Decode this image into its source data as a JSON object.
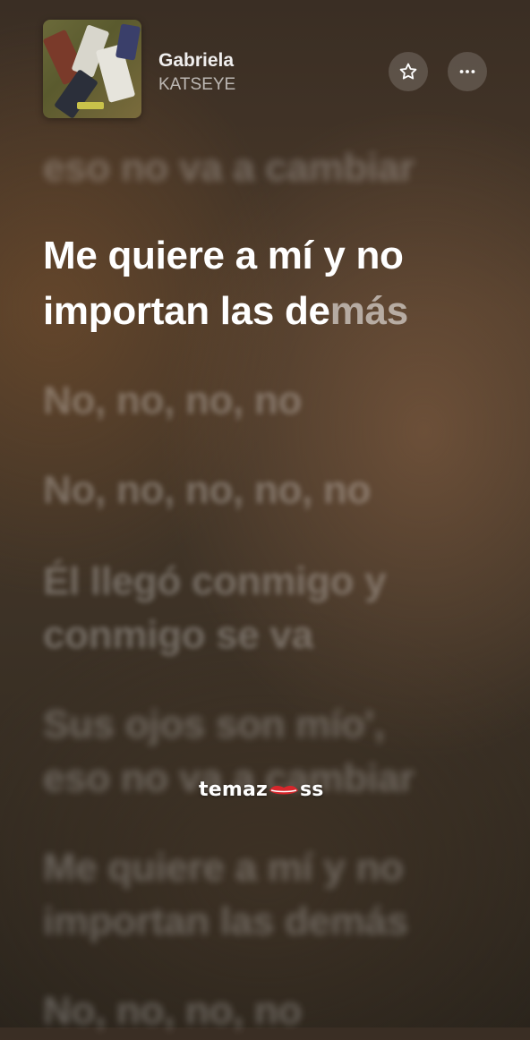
{
  "now_playing": {
    "title": "Gabriela",
    "artist": "KATSEYE"
  },
  "controls": {
    "favorite_icon": "star-icon",
    "more_icon": "ellipsis-icon"
  },
  "lyrics": {
    "previous": "eso no va a cambiar",
    "current_line_1": "Me quiere a mí y no",
    "current_line_2_sung": "importan las de",
    "current_line_2_unsung": "más",
    "upcoming": [
      "No, no, no, no",
      "No, no, no, no, no",
      "Él llegó conmigo y",
      "conmigo se va",
      "Sus ojos son mío',",
      "eso no va a cambiar",
      "Me quiere a mí y no",
      "importan las demás",
      "No, no, no, no"
    ]
  },
  "watermark": {
    "text_start": "temaz",
    "text_end": "ss"
  },
  "colors": {
    "background": "#3a2e24",
    "active_lyric": "#ffffff",
    "watermark_lips": "#d8262b"
  }
}
